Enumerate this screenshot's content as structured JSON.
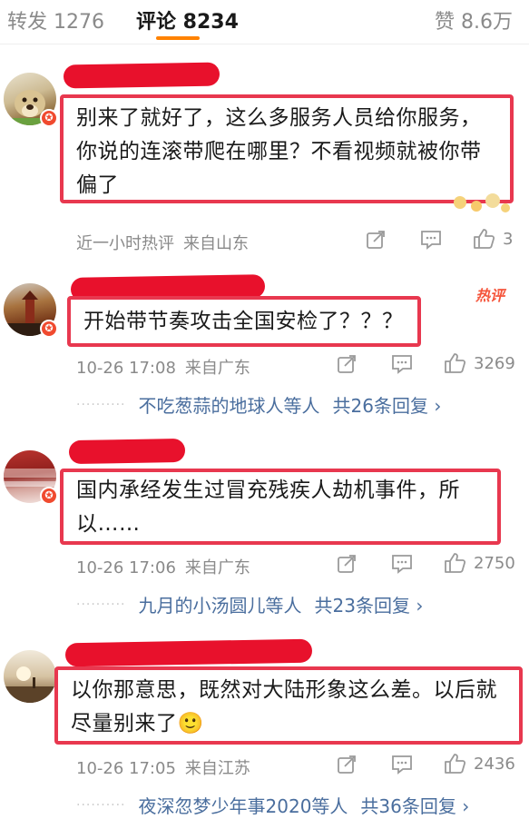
{
  "tabs": {
    "repost": "转发 1276",
    "comments": "评论 8234",
    "likes": "赞 8.6万"
  },
  "comments": [
    {
      "text": "别来了就好了，这么多服务人员给你服务，你说的连滚带爬在哪里？不看视频就被你带偏了",
      "time": "近一小时热评",
      "location": "来自山东",
      "likes": "3"
    },
    {
      "text": "开始带节奏攻击全国安检了？？？",
      "hot_tag": "热评",
      "time": "10-26 17:08",
      "location": "来自广东",
      "likes": "3269",
      "reply_users": "不吃葱蒜的地球人等人",
      "reply_count": "共26条回复 ›"
    },
    {
      "text": "国内承经发生过冒充残疾人劫机事件，所以……",
      "time": "10-26 17:06",
      "location": "来自广东",
      "likes": "2750",
      "reply_users": "九月的小汤圆儿等人",
      "reply_count": "共23条回复 ›"
    },
    {
      "text": "以你那意思，既然对大陆形象这么差。以后就尽量别来了🙂",
      "time": "10-26 17:05",
      "location": "来自江苏",
      "likes": "2436",
      "reply_users": "夜深忽梦少年事2020等人",
      "reply_count": "共36条回复 ›"
    }
  ],
  "colors": {
    "accent": "#ff8200",
    "highlight_box": "#e8384f",
    "redaction": "#e8112c",
    "link": "#4a6e9e",
    "meta": "#8a8a8a"
  }
}
